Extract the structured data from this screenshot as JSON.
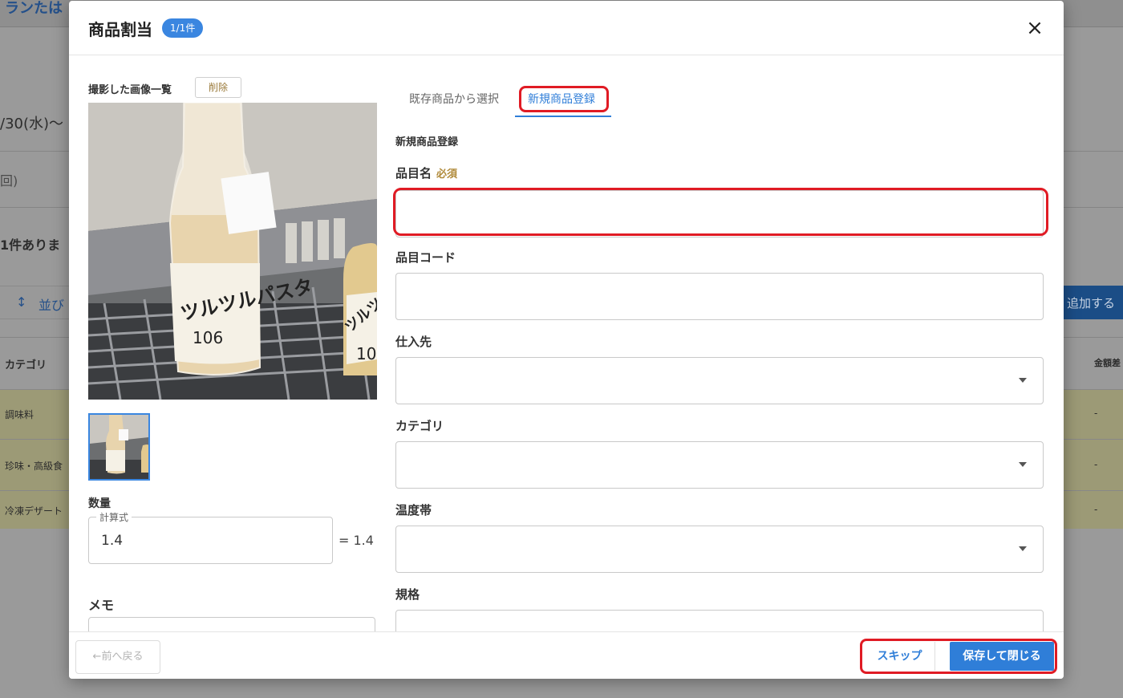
{
  "background": {
    "header_fragment": "ランたは",
    "date_fragment": "/30(水)〜",
    "count_fragment": "回)",
    "notice_fragment": "1件ありま",
    "sort_label": "並び",
    "add_button": "追加する",
    "table_header_category": "カテゴリ",
    "table_header_amount": "金額差",
    "rows": [
      {
        "category": "調味料",
        "amount": "-"
      },
      {
        "category": "珍味・高級食",
        "amount": "-"
      },
      {
        "category": "冷凍デザート",
        "amount": "-"
      }
    ]
  },
  "modal": {
    "title": "商品割当",
    "badge": "1/1件",
    "close_icon": "×",
    "images": {
      "label": "撮影した画像一覧",
      "delete_label": "削除",
      "photo_label_text": "ツルツルパスタ",
      "photo_label_number": "106",
      "photo_second_text": "ツルツ",
      "photo_second_number": "10"
    },
    "quantity": {
      "label": "数量",
      "formula_legend": "計算式",
      "formula_value": "1.4",
      "result": "= 1.4"
    },
    "memo": {
      "label": "メモ"
    },
    "tabs": [
      {
        "label": "既存商品から選択",
        "active": false
      },
      {
        "label": "新規商品登録",
        "active": true
      }
    ],
    "form": {
      "section_title": "新規商品登録",
      "item_name_label": "品目名",
      "required_label": "必須",
      "item_name_value": "",
      "item_code_label": "品目コード",
      "item_code_value": "",
      "supplier_label": "仕入先",
      "category_label": "カテゴリ",
      "temperature_label": "温度帯",
      "spec_label": "規格"
    },
    "footer": {
      "back_label": "←前へ戻る",
      "skip_label": "スキップ",
      "save_label": "保存して閉じる"
    }
  },
  "colors": {
    "accent": "#2f7ed8",
    "highlight": "#e01b24",
    "required": "#b08a3a"
  }
}
